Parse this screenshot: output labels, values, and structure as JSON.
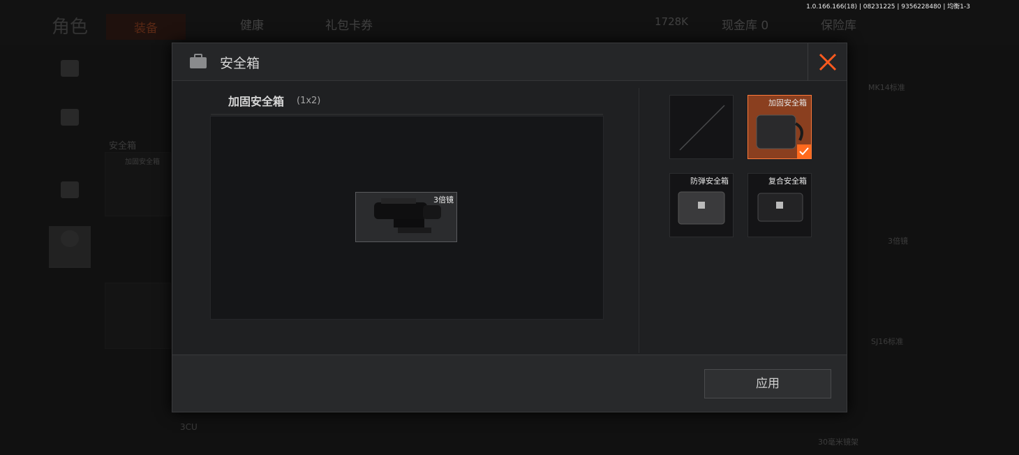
{
  "status": "1.0.166.166(18) | 08231225 | 9356228480 | 均衡1-3",
  "background": {
    "top_tabs": [
      "角色",
      "装备",
      "健康",
      "礼包卡券"
    ],
    "currency": "1728K",
    "cash_vault": "现金库 0",
    "safe_vault": "保险库",
    "left_section_label": "安全箱",
    "left_case_label": "加固安全箱",
    "bottom_left_label": "3CU",
    "right_labels": [
      "MK14标准",
      "3倍镜",
      "SJ16标准",
      "30毫米镜架"
    ]
  },
  "modal": {
    "title": "安全箱",
    "preview_title": "加固安全箱",
    "preview_size": "(1x2)",
    "inventory_item": "3倍镜",
    "cases": [
      {
        "name": "",
        "state": "empty"
      },
      {
        "name": "加固安全箱",
        "state": "selected"
      },
      {
        "name": "防弹安全箱",
        "state": "locked"
      },
      {
        "name": "复合安全箱",
        "state": "locked"
      }
    ],
    "apply_label": "应用"
  },
  "colors": {
    "accent": "#ff6a1e",
    "selected_bg": "#8a3f1f",
    "modal_bg": "#1f2022"
  }
}
